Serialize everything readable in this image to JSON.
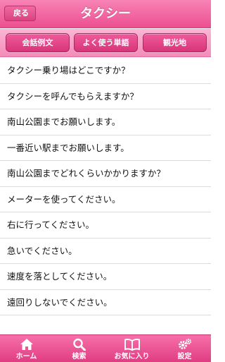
{
  "navbar": {
    "back_label": "戻る",
    "title": "タクシー"
  },
  "categories": [
    {
      "label": "会話例文"
    },
    {
      "label": "よく使う単語"
    },
    {
      "label": "観光地"
    }
  ],
  "phrases": [
    "タクシー乗り場はどこですか？",
    "タクシーを呼んでもらえますか？",
    "南山公園までお願いします。",
    "一番近い駅までお願いします。",
    "南山公園までどれくらいかかりますか？",
    "メーターを使ってください。",
    "右に行ってください。",
    "急いでください。",
    "速度を落としてください。",
    "遠回りしないでください。"
  ],
  "tabbar": {
    "items": [
      {
        "label": "ホーム",
        "icon": "home-icon"
      },
      {
        "label": "検索",
        "icon": "search-icon"
      },
      {
        "label": "お気に入り",
        "icon": "book-icon"
      },
      {
        "label": "設定",
        "icon": "gears-icon"
      }
    ]
  },
  "colors": {
    "accent": "#ec4f91",
    "segment_bar": "#f7a3c8",
    "button": "#dc3d80"
  }
}
